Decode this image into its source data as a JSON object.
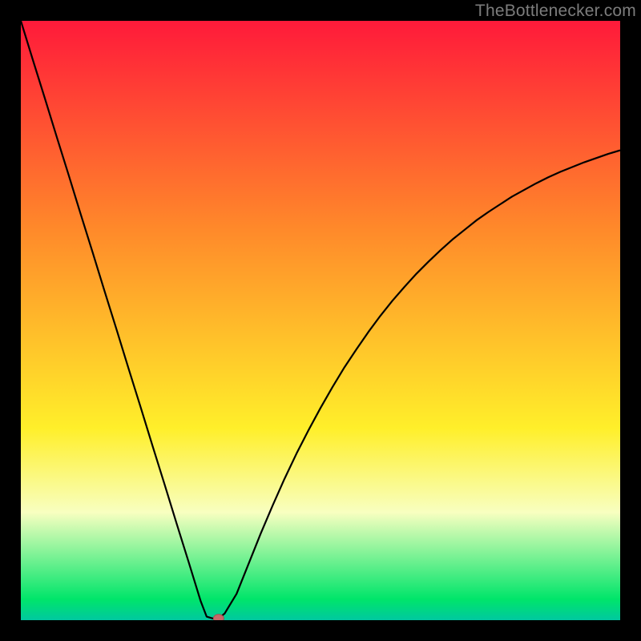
{
  "watermark": "TheBottlenecker.com",
  "colors": {
    "top": "#ff1a3a",
    "mid_orange": "#ff8a2a",
    "yellow": "#ffef2a",
    "pale": "#f4ffb8",
    "green": "#00e56a",
    "teal": "#00c8a0",
    "curve": "#000000",
    "marker_fill": "#c46a6a",
    "marker_stroke": "#a84f4f",
    "frame": "#000000"
  },
  "chart_data": {
    "type": "line",
    "title": "",
    "xlabel": "",
    "ylabel": "",
    "xlim": [
      0,
      100
    ],
    "ylim": [
      0,
      100
    ],
    "grid": false,
    "legend": false,
    "x": [
      0,
      2,
      4,
      6,
      8,
      10,
      12,
      14,
      16,
      18,
      20,
      22,
      24,
      26,
      28,
      30,
      31,
      32,
      33,
      34,
      36,
      38,
      40,
      42,
      44,
      46,
      48,
      50,
      52,
      54,
      56,
      58,
      60,
      62,
      64,
      66,
      68,
      70,
      72,
      74,
      76,
      78,
      80,
      82,
      84,
      86,
      88,
      90,
      92,
      94,
      96,
      98,
      100
    ],
    "values": [
      100.0,
      93.5,
      87.1,
      80.6,
      74.2,
      67.7,
      61.3,
      54.8,
      48.4,
      41.9,
      35.5,
      29.0,
      22.6,
      16.1,
      9.7,
      3.2,
      0.6,
      0.3,
      0.3,
      1.1,
      4.4,
      9.4,
      14.4,
      19.1,
      23.6,
      27.8,
      31.7,
      35.4,
      38.9,
      42.2,
      45.2,
      48.1,
      50.8,
      53.3,
      55.6,
      57.8,
      59.8,
      61.7,
      63.5,
      65.1,
      66.7,
      68.1,
      69.4,
      70.7,
      71.8,
      72.9,
      73.9,
      74.8,
      75.6,
      76.4,
      77.1,
      77.8,
      78.4
    ],
    "marker": {
      "x": 33,
      "y": 0.3
    },
    "background_gradient_stops": [
      {
        "offset": 0.0,
        "color": "#ff1a3a"
      },
      {
        "offset": 0.35,
        "color": "#ff8a2a"
      },
      {
        "offset": 0.68,
        "color": "#ffef2a"
      },
      {
        "offset": 0.82,
        "color": "#f8ffc0"
      },
      {
        "offset": 0.965,
        "color": "#00e56a"
      },
      {
        "offset": 1.0,
        "color": "#00c8a0"
      }
    ]
  }
}
